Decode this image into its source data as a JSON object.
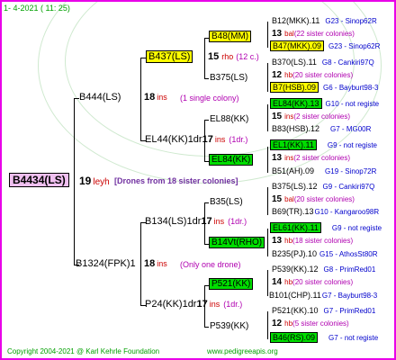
{
  "header": {
    "date": "1-  4-2021 ( 11:  25)"
  },
  "footer": {
    "copyright": "Copyright 2004-2021 @ Karl Kehrle Foundation",
    "site": "www.pedigreeapis.org"
  },
  "root": {
    "id": "B4434(LS)",
    "num": "19",
    "suffix": "ley",
    "hf": "h",
    "note": "[Drones from 18 sister colonies]"
  },
  "gen1": [
    {
      "id": "B444(LS)",
      "num": "18",
      "suffix": "ins",
      "note": "(1 single colony)"
    },
    {
      "id": "B1324(FPK)1",
      "num": "18",
      "suffix": "ins",
      "note": "(Only one drone)"
    }
  ],
  "gen2": [
    {
      "id": "B437(LS)",
      "num": "15",
      "suffix": "rho",
      "note": "(12 c.)"
    },
    {
      "id": "EL44(KK)1dr",
      "num": "17",
      "suffix": "ins",
      "note": "(1dr.)"
    },
    {
      "id": "B134(LS)1dr",
      "num": "17",
      "suffix": "ins",
      "note": "(1dr.)"
    },
    {
      "id": "P24(KK)1dr",
      "num": "17",
      "suffix": "ins",
      "note": "(1dr.)"
    }
  ],
  "gen3": [
    {
      "id": "B48(MM)"
    },
    {
      "id": "B375(LS)"
    },
    {
      "id": "EL88(KK)"
    },
    {
      "id": "EL84(KK)"
    },
    {
      "id": "B35(LS)"
    },
    {
      "id": "B14Vt(RHO)"
    },
    {
      "id": "P521(KK)"
    },
    {
      "id": "P539(KK)"
    }
  ],
  "gen4": [
    {
      "top": "B12(MKK).11",
      "top_note": "G23 - Sinop62R",
      "num": "13",
      "suffix": "bal",
      "mid_note": "(22 sister colonies)",
      "bot": "B47(MKK).09",
      "bot_note": "G23 - Sinop62R"
    },
    {
      "top": "B370(LS).11",
      "top_note": "G8 - Cankiri97Q",
      "num": "12",
      "suffix": "hb",
      "mid_note": "(20 sister colonies)",
      "bot": "B7(HSB).09",
      "bot_note": "G6 - Bayburt98-3"
    },
    {
      "top": "EL84(KK).13",
      "top_note": "G10 - not registe",
      "num": "15",
      "suffix": "ins",
      "mid_note": "(2 sister colonies)",
      "bot": "B83(HSB).12",
      "bot_note": "G7 - MG00R"
    },
    {
      "top": "EL1(KK).11",
      "top_note": "G9 - not registe",
      "num": "13",
      "suffix": "ins",
      "mid_note": "(2 sister colonies)",
      "bot": "B51(AH).09",
      "bot_note": "G19 - Sinop72R"
    },
    {
      "top": "B375(LS).12",
      "top_note": "G9 - Cankiri97Q",
      "num": "15",
      "suffix": "bal",
      "mid_note": "(20 sister colonies)",
      "bot": "B69(TR).13",
      "bot_note": "G10 - Kangaroo98R"
    },
    {
      "top": "EL61(KK).11",
      "top_note": "G9 - not registe",
      "num": "13",
      "suffix": "hb",
      "mid_note": "(18 sister colonies)",
      "bot": "B235(PJ).10",
      "bot_note": "G15 - AthosSt80R"
    },
    {
      "top": "P539(KK).12",
      "top_note": "G8 - PrimRed01",
      "num": "14",
      "suffix": "hb",
      "mid_note": "(20 sister colonies)",
      "bot": "B101(CHP).11",
      "bot_note": "G7 - Bayburt98-3"
    },
    {
      "top": "P521(KK).10",
      "top_note": "G7 - PrimRed01",
      "num": "12",
      "suffix": "hb",
      "mid_note": "(5 sister colonies)",
      "bot": "B46(RS).09",
      "bot_note": "G7 - not registe"
    }
  ]
}
